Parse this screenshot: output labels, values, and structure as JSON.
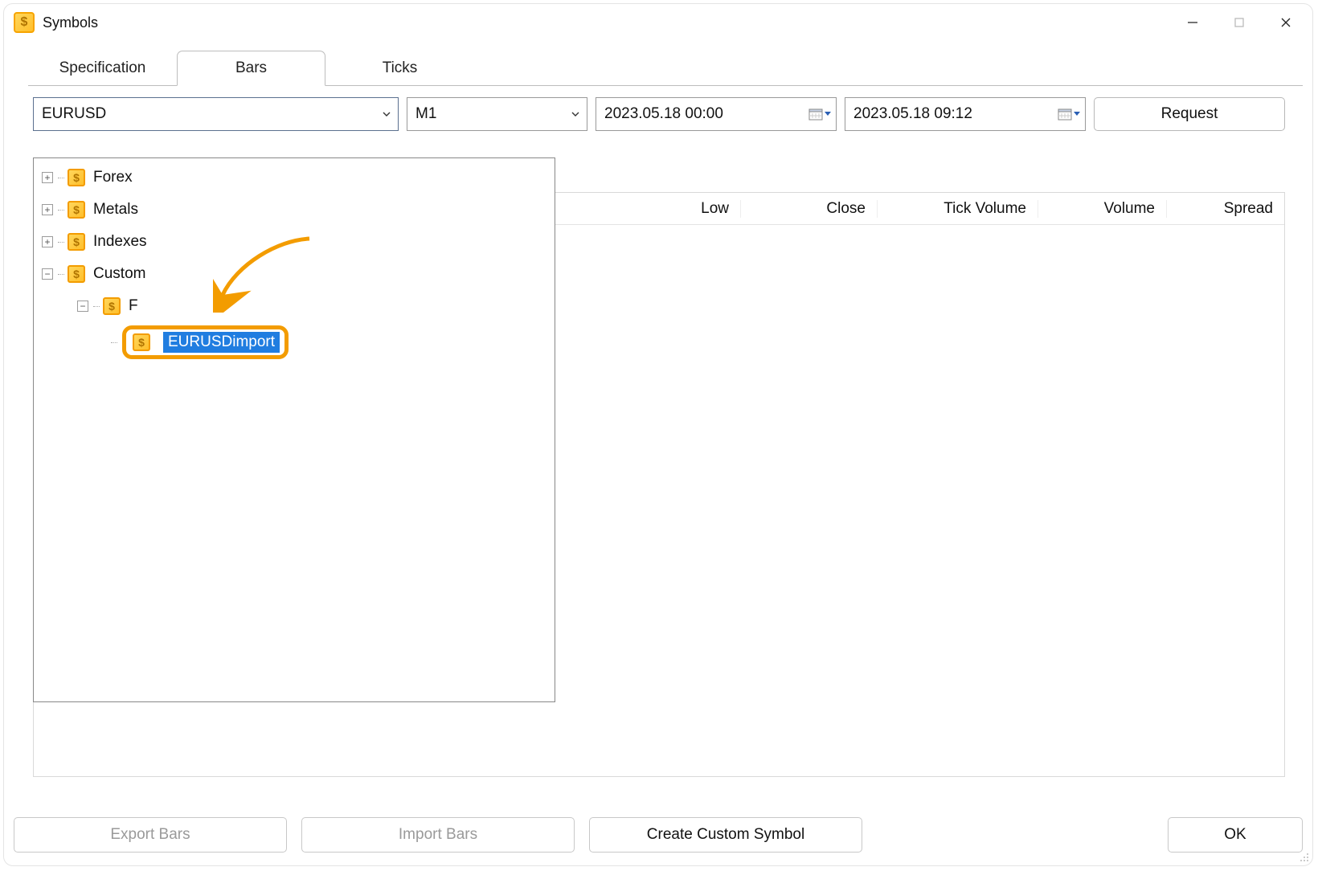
{
  "window": {
    "title": "Symbols"
  },
  "tabs": {
    "spec": "Specification",
    "bars": "Bars",
    "ticks": "Ticks"
  },
  "controls": {
    "symbol": "EURUSD",
    "timeframe": "M1",
    "dt_from": "2023.05.18 00:00",
    "dt_to": "2023.05.18 09:12",
    "request_label": "Request"
  },
  "columns": {
    "low": "Low",
    "close": "Close",
    "tick_volume": "Tick Volume",
    "volume": "Volume",
    "spread": "Spread"
  },
  "tree": {
    "items": [
      {
        "label": "Forex",
        "expand": "+"
      },
      {
        "label": "Metals",
        "expand": "+"
      },
      {
        "label": "Indexes",
        "expand": "+"
      },
      {
        "label": "Custom",
        "expand": "−"
      }
    ],
    "custom_child_prefix": "F",
    "selected_symbol": "EURUSDimport"
  },
  "buttons": {
    "export": "Export Bars",
    "import": "Import Bars",
    "create": "Create Custom Symbol",
    "ok": "OK"
  }
}
